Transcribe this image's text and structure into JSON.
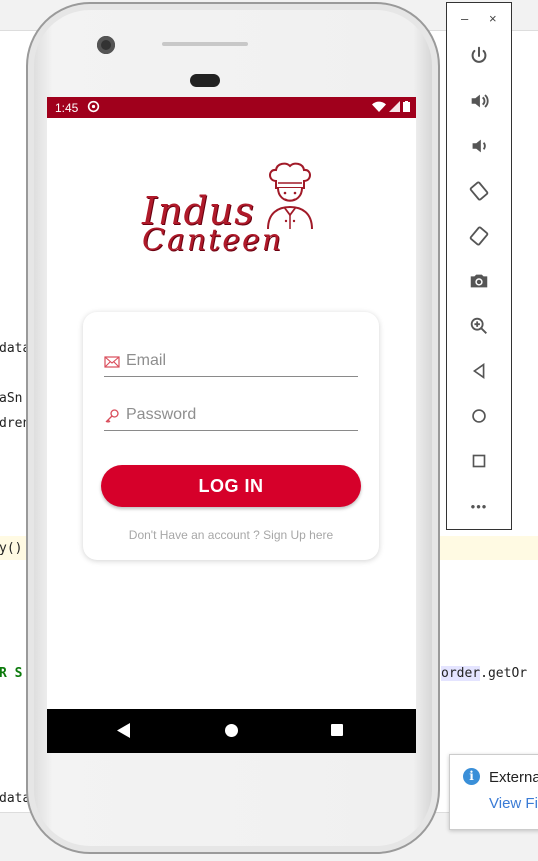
{
  "ide": {
    "code_fragments": [
      "data",
      "aSn",
      "dren",
      "y()",
      "R S",
      "order.getOr",
      "data"
    ]
  },
  "emulator_toolbar": {
    "minimize": "–",
    "close": "×",
    "buttons": [
      "power-icon",
      "volume-up-icon",
      "volume-down-icon",
      "rotate-left-icon",
      "rotate-right-icon",
      "camera-icon",
      "zoom-icon",
      "back-icon",
      "home-icon",
      "overview-icon",
      "more-icon"
    ],
    "more_label": "•••"
  },
  "toast": {
    "icon_label": "i",
    "title": "Externa",
    "link": "View Fil"
  },
  "phone": {
    "status": {
      "time": "1:45"
    },
    "logo": {
      "line1": "Indus",
      "line2": "Canteen"
    },
    "login": {
      "email_placeholder": "Email",
      "password_placeholder": "Password",
      "button_label": "LOG IN",
      "signup_text": "Don't Have an account ? Sign Up here"
    }
  },
  "colors": {
    "status_bar": "#a0001c",
    "primary": "#d6002a",
    "logo_text": "#b01a2a"
  }
}
